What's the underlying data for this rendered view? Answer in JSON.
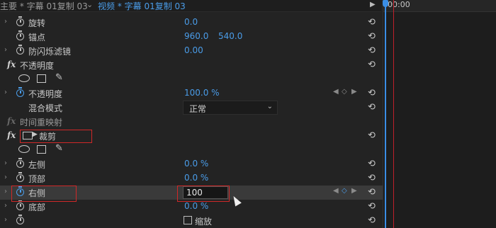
{
  "header": {
    "master_tab": "主要 * 字幕 01复制 03",
    "clip_tab": "视频 * 字幕 01复制 03"
  },
  "timeline": {
    "timecode": "00:00"
  },
  "rows": {
    "rotation": {
      "label": "旋转",
      "value": "0.0"
    },
    "anchor": {
      "label": "锚点",
      "x": "960.0",
      "y": "540.0"
    },
    "antiflicker": {
      "label": "防闪烁滤镜",
      "value": "0.00"
    },
    "opacity_section": {
      "fx": "fx",
      "label": "不透明度"
    },
    "opacity": {
      "label": "不透明度",
      "value": "100.0 %"
    },
    "blend": {
      "label": "混合模式",
      "value": "正常"
    },
    "time_remap": {
      "fx": "fx",
      "label": "时间重映射"
    },
    "crop_section": {
      "fx": "fx",
      "label": "裁剪"
    },
    "left": {
      "label": "左侧",
      "value": "0.0 %"
    },
    "top": {
      "label": "顶部",
      "value": "0.0 %"
    },
    "right": {
      "label": "右侧",
      "value": "100"
    },
    "bottom": {
      "label": "底部",
      "value": "0.0 %"
    },
    "zoom": {
      "label": "缩放"
    }
  },
  "icons": {
    "reset": "reset-icon",
    "stopwatch": "stopwatch-icon",
    "pen": "pen-icon"
  },
  "colors": {
    "accent": "#4a9ce8",
    "highlight": "#d02828",
    "background": "#232323"
  }
}
